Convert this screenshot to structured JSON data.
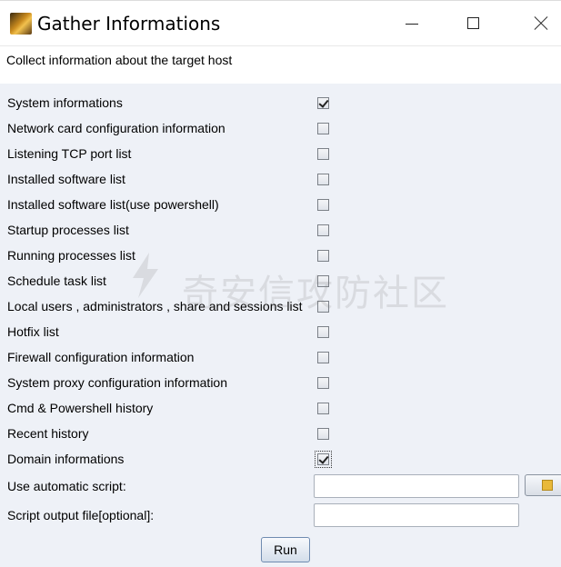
{
  "window": {
    "title": "Gather Informations",
    "icon": "app-icon"
  },
  "header": {
    "description": "Collect information about the target host"
  },
  "options": [
    {
      "label": "System informations",
      "checked": true
    },
    {
      "label": "Network card configuration information",
      "checked": false
    },
    {
      "label": "Listening TCP port list",
      "checked": false
    },
    {
      "label": "Installed software list",
      "checked": false
    },
    {
      "label": "Installed software list(use powershell)",
      "checked": false
    },
    {
      "label": "Startup processes list",
      "checked": false
    },
    {
      "label": "Running processes list",
      "checked": false
    },
    {
      "label": "Schedule task list",
      "checked": false
    },
    {
      "label": "Local users , administrators , share and sessions list",
      "checked": false
    },
    {
      "label": "Hotfix list",
      "checked": false
    },
    {
      "label": "Firewall configuration information",
      "checked": false
    },
    {
      "label": "System proxy configuration information",
      "checked": false
    },
    {
      "label": "Cmd & Powershell history",
      "checked": false
    },
    {
      "label": "Recent history",
      "checked": false
    },
    {
      "label": "Domain informations",
      "checked": true,
      "focused": true
    }
  ],
  "script": {
    "label": "Use automatic script:",
    "value": ""
  },
  "output": {
    "label": "Script output file[optional]:",
    "value": ""
  },
  "run_label": "Run",
  "watermark": "奇安信攻防社区"
}
